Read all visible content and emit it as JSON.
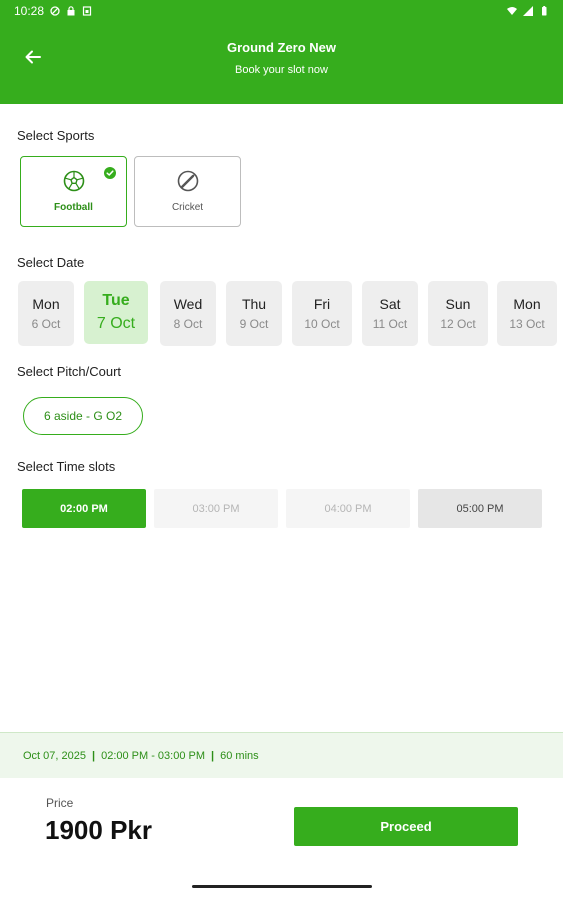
{
  "status_bar": {
    "time": "10:28"
  },
  "header": {
    "title": "Ground Zero New",
    "subtitle": "Book your slot now"
  },
  "sports": {
    "title": "Select Sports",
    "items": [
      {
        "label": "Football",
        "icon": "football-icon",
        "selected": true
      },
      {
        "label": "Cricket",
        "icon": "cricket-icon",
        "selected": false
      }
    ]
  },
  "dates": {
    "title": "Select Date",
    "items": [
      {
        "day": "Mon",
        "date": "6 Oct",
        "selected": false
      },
      {
        "day": "Tue",
        "date": "7 Oct",
        "selected": true
      },
      {
        "day": "Wed",
        "date": "8 Oct",
        "selected": false
      },
      {
        "day": "Thu",
        "date": "9 Oct",
        "selected": false
      },
      {
        "day": "Fri",
        "date": "10 Oct",
        "selected": false
      },
      {
        "day": "Sat",
        "date": "11 Oct",
        "selected": false
      },
      {
        "day": "Sun",
        "date": "12 Oct",
        "selected": false
      },
      {
        "day": "Mon",
        "date": "13 Oct",
        "selected": false
      }
    ]
  },
  "pitch": {
    "title": "Select Pitch/Court",
    "selected": "6 aside - G O2"
  },
  "slots": {
    "title": "Select Time slots",
    "items": [
      {
        "label": "02:00 PM",
        "state": "selected"
      },
      {
        "label": "03:00 PM",
        "state": "disabled"
      },
      {
        "label": "04:00 PM",
        "state": "disabled"
      },
      {
        "label": "05:00 PM",
        "state": "available"
      }
    ]
  },
  "summary": {
    "date": "Oct 07, 2025",
    "time_range": "02:00 PM - 03:00 PM",
    "duration": "60 mins",
    "separator": "|"
  },
  "footer": {
    "price_label": "Price",
    "price_value": "1900 Pkr",
    "proceed_label": "Proceed"
  },
  "colors": {
    "primary": "#36ad1d",
    "selected_date_bg": "#d7f1d0",
    "summary_bg": "#eef7ec"
  }
}
